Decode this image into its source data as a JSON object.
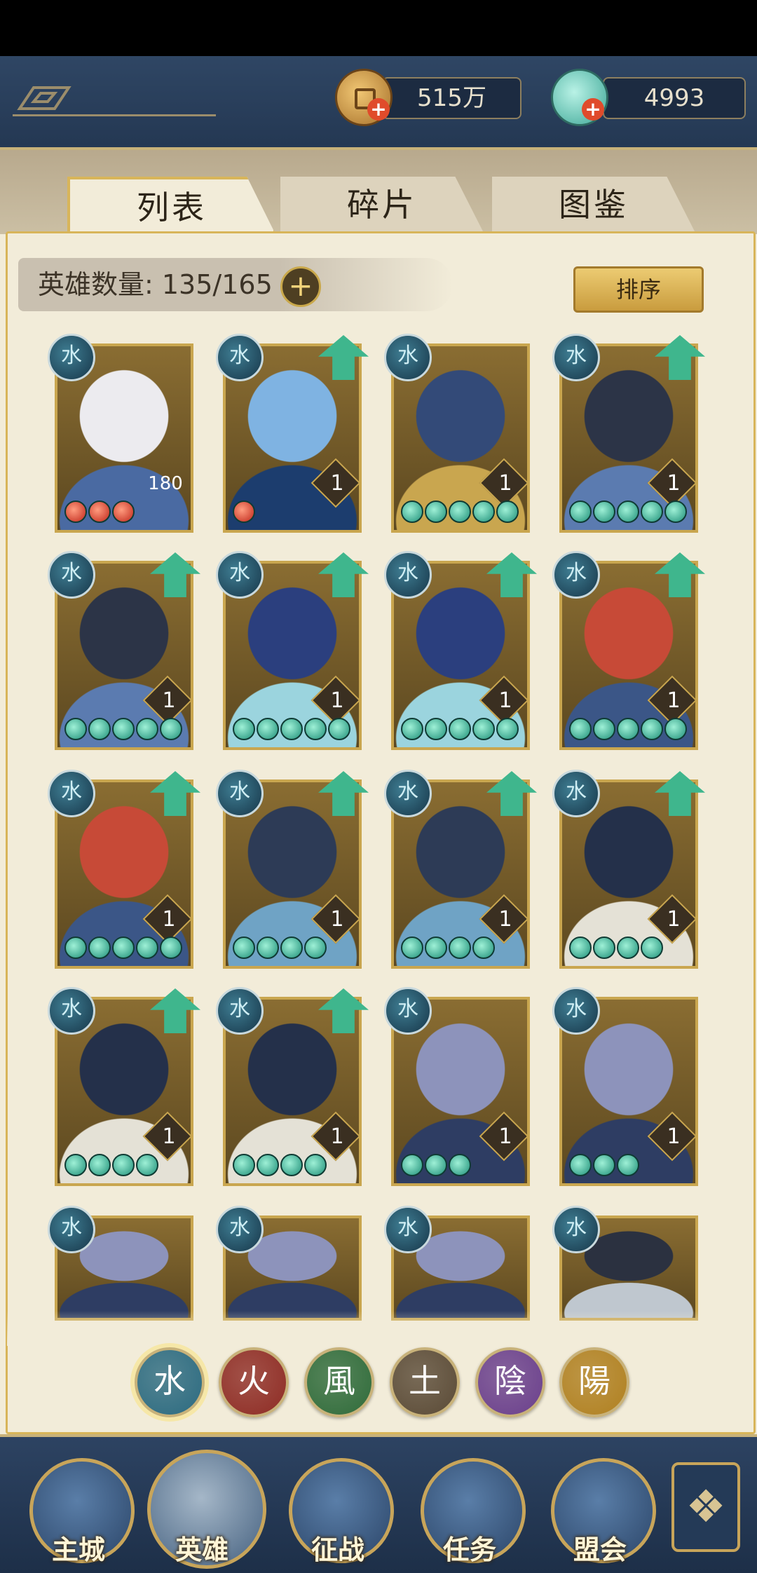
{
  "currency": {
    "coins": "515万",
    "jade": "4993"
  },
  "tabs": [
    {
      "label": "列表",
      "active": true
    },
    {
      "label": "碎片",
      "active": false
    },
    {
      "label": "图鉴",
      "active": false
    }
  ],
  "hero_count": {
    "text": "英雄数量: 135/165"
  },
  "sort_button": "排序",
  "colors": {
    "accent_gold": "#c9a64f",
    "navy": "#2f4664",
    "star_green": "#1e8f78",
    "star_red": "#c0261a",
    "upgrade_green": "#3fb68d"
  },
  "heroes": [
    {
      "element": "水",
      "level": "180",
      "stars": 3,
      "star_color": "red",
      "upgrade": false
    },
    {
      "element": "水",
      "level": "1",
      "stars": 1,
      "star_color": "red",
      "upgrade": true
    },
    {
      "element": "水",
      "level": "1",
      "stars": 5,
      "star_color": "green",
      "upgrade": false
    },
    {
      "element": "水",
      "level": "1",
      "stars": 5,
      "star_color": "green",
      "upgrade": true
    },
    {
      "element": "水",
      "level": "1",
      "stars": 5,
      "star_color": "green",
      "upgrade": true
    },
    {
      "element": "水",
      "level": "1",
      "stars": 5,
      "star_color": "green",
      "upgrade": true
    },
    {
      "element": "水",
      "level": "1",
      "stars": 5,
      "star_color": "green",
      "upgrade": true
    },
    {
      "element": "水",
      "level": "1",
      "stars": 5,
      "star_color": "green",
      "upgrade": true
    },
    {
      "element": "水",
      "level": "1",
      "stars": 5,
      "star_color": "green",
      "upgrade": true
    },
    {
      "element": "水",
      "level": "1",
      "stars": 4,
      "star_color": "green",
      "upgrade": true
    },
    {
      "element": "水",
      "level": "1",
      "stars": 4,
      "star_color": "green",
      "upgrade": true
    },
    {
      "element": "水",
      "level": "1",
      "stars": 4,
      "star_color": "green",
      "upgrade": true
    },
    {
      "element": "水",
      "level": "1",
      "stars": 4,
      "star_color": "green",
      "upgrade": true
    },
    {
      "element": "水",
      "level": "1",
      "stars": 4,
      "star_color": "green",
      "upgrade": true
    },
    {
      "element": "水",
      "level": "1",
      "stars": 3,
      "star_color": "green",
      "upgrade": false
    },
    {
      "element": "水",
      "level": "1",
      "stars": 3,
      "star_color": "green",
      "upgrade": false
    },
    {
      "element": "水",
      "level": "",
      "stars": 0,
      "star_color": "green",
      "upgrade": false
    },
    {
      "element": "水",
      "level": "",
      "stars": 0,
      "star_color": "green",
      "upgrade": false
    },
    {
      "element": "水",
      "level": "",
      "stars": 0,
      "star_color": "green",
      "upgrade": false
    },
    {
      "element": "水",
      "level": "",
      "stars": 0,
      "star_color": "green",
      "upgrade": false
    }
  ],
  "element_filters": [
    {
      "label": "水",
      "color": "#2b6a80",
      "active": true
    },
    {
      "label": "火",
      "color": "#8e2b24",
      "active": false
    },
    {
      "label": "風",
      "color": "#2f6b3a",
      "active": false
    },
    {
      "label": "土",
      "color": "#5a4a36",
      "active": false
    },
    {
      "label": "陰",
      "color": "#6a3f8c",
      "active": false
    },
    {
      "label": "陽",
      "color": "#b08020",
      "active": false
    }
  ],
  "bottom_nav": [
    {
      "label": "主城",
      "active": false
    },
    {
      "label": "英雄",
      "active": true
    },
    {
      "label": "征战",
      "active": false
    },
    {
      "label": "任务",
      "active": false
    },
    {
      "label": "盟会",
      "active": false
    }
  ]
}
